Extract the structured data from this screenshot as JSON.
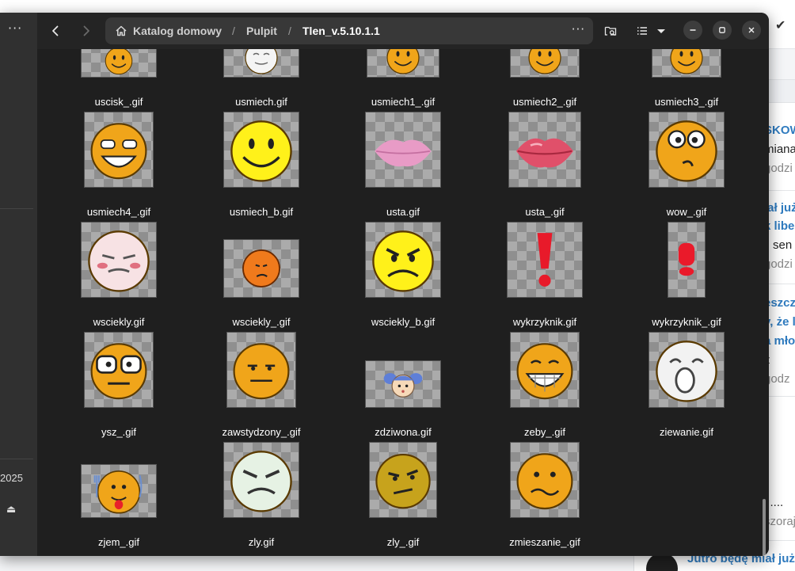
{
  "window": {
    "breadcrumbs": [
      "Katalog domowy",
      "Pulpit",
      "Tlen_v.5.10.1.1"
    ],
    "separator": "/",
    "path_menu_glyph": "···",
    "sidebar_menu_glyph": "···",
    "sidebar_year": "2025",
    "sidebar_eject_glyph": "⏏"
  },
  "icons": {
    "back": "chevron-left-icon",
    "forward": "chevron-right-icon",
    "home": "home-icon",
    "search": "search-folder-icon",
    "view": "list-view-icon",
    "view_dropdown": "chevron-down-icon",
    "minimize": "minimize-icon",
    "maximize": "maximize-icon",
    "close": "close-icon"
  },
  "files": [
    {
      "name": "uscisk_.gif",
      "kind": "smile"
    },
    {
      "name": "usmiech.gif",
      "kind": "white"
    },
    {
      "name": "usmiech1_.gif",
      "kind": "smile"
    },
    {
      "name": "usmiech2_.gif",
      "kind": "smile"
    },
    {
      "name": "usmiech3_.gif",
      "kind": "smile"
    },
    {
      "name": "usmiech4_.gif",
      "kind": "grin"
    },
    {
      "name": "usmiech_b.gif",
      "kind": "bigsmile"
    },
    {
      "name": "usta.gif",
      "kind": "lips-light"
    },
    {
      "name": "usta_.gif",
      "kind": "lips"
    },
    {
      "name": "wow_.gif",
      "kind": "wow"
    },
    {
      "name": "wsciekly.gif",
      "kind": "pink"
    },
    {
      "name": "wsciekly_.gif",
      "kind": "orange"
    },
    {
      "name": "wsciekly_b.gif",
      "kind": "angry-big"
    },
    {
      "name": "wykrzyknik.gif",
      "kind": "exclaim"
    },
    {
      "name": "wykrzyknik_.gif",
      "kind": "exclaim-big"
    },
    {
      "name": "ysz_.gif",
      "kind": "glasses"
    },
    {
      "name": "zawstydzony_.gif",
      "kind": "shy"
    },
    {
      "name": "zdziwona.gif",
      "kind": "girl"
    },
    {
      "name": "zeby_.gif",
      "kind": "teeth"
    },
    {
      "name": "ziewanie.gif",
      "kind": "yawn"
    },
    {
      "name": "zjem_.gif",
      "kind": "eat"
    },
    {
      "name": "zly.gif",
      "kind": "green"
    },
    {
      "name": "zly_.gif",
      "kind": "mad"
    },
    {
      "name": "zmieszanie_.gif",
      "kind": "confused"
    }
  ],
  "background_page": {
    "snippets": [
      "SKOW",
      "miana",
      "godzi",
      "iał już",
      "k libe",
      "sen",
      "godzi",
      "eszcz",
      "y, że l",
      "a mło",
      "z",
      "godz",
      "i ....",
      "szoraj"
    ],
    "bottom_text": "Jutro będę miał już"
  },
  "colors": {
    "window_bg": "#242424",
    "content_bg": "#1f1f1f",
    "pathbar_bg": "#383838",
    "link_blue": "#2f7bbf"
  }
}
